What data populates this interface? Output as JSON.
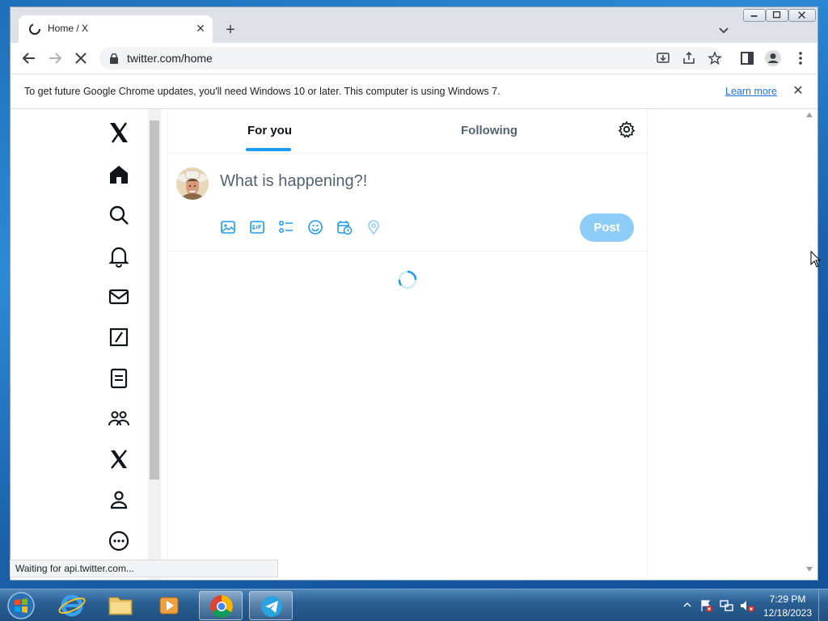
{
  "browser": {
    "tab_title": "Home / X",
    "url": "twitter.com/home",
    "infobar_text": "To get future Google Chrome updates, you'll need Windows 10 or later. This computer is using Windows 7.",
    "infobar_link": "Learn more",
    "status_text": "Waiting for api.twitter.com..."
  },
  "x": {
    "tabs": [
      {
        "label": "For you",
        "selected": true
      },
      {
        "label": "Following",
        "selected": false
      }
    ],
    "compose_placeholder": "What is happening?!",
    "post_label": "Post",
    "accent": "#1d9bf0",
    "nav_icons": [
      "x-logo-icon",
      "home-icon",
      "search-icon",
      "notifications-icon",
      "messages-icon",
      "grok-icon",
      "lists-icon",
      "communities-icon",
      "premium-icon",
      "profile-icon",
      "more-icon"
    ],
    "compose_tools": [
      "image-icon",
      "gif-icon",
      "poll-icon",
      "emoji-icon",
      "schedule-icon",
      "location-icon"
    ]
  },
  "taskbar": {
    "time": "7:29 PM",
    "date": "12/18/2023"
  }
}
